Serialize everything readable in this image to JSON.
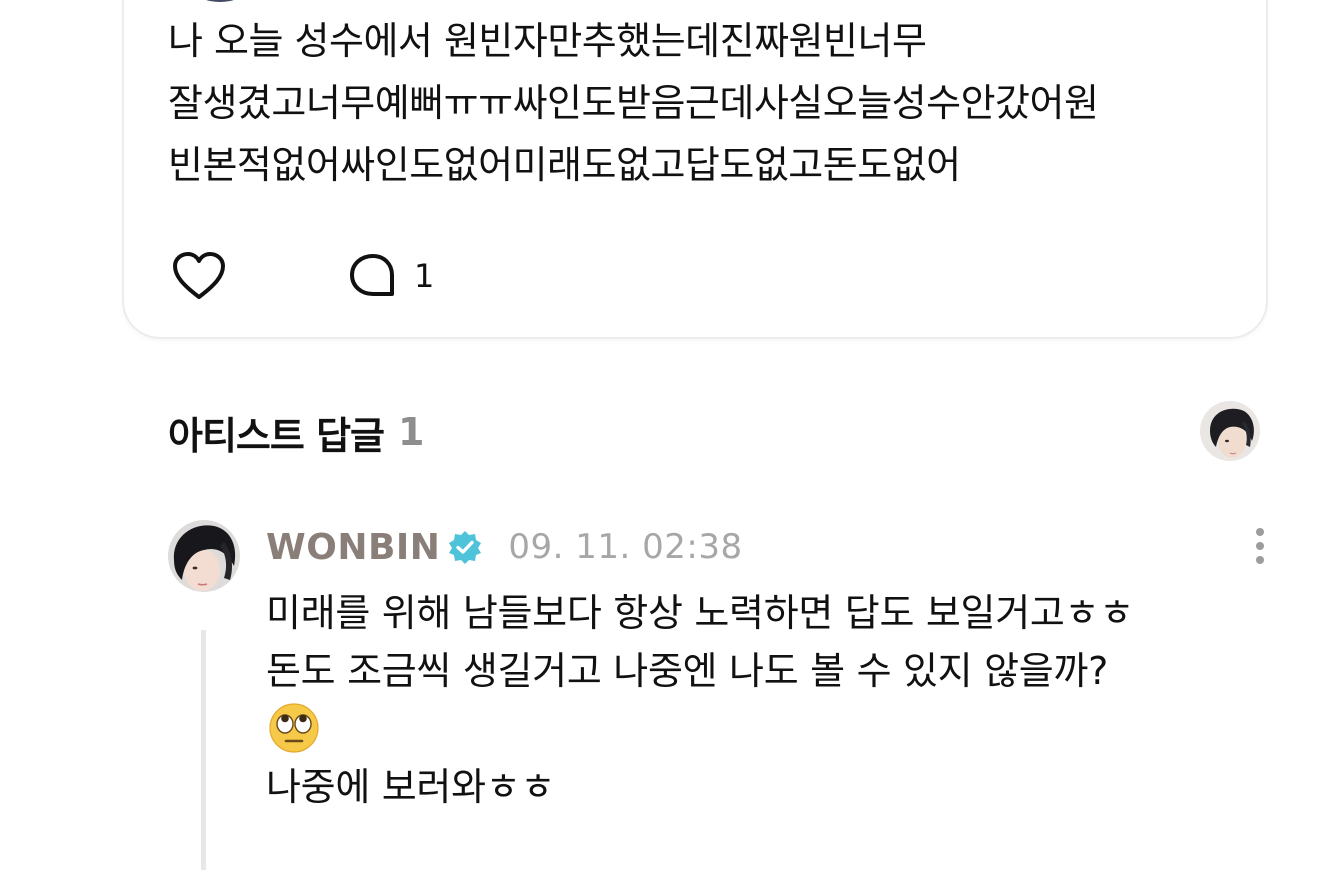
{
  "post": {
    "text": "나 오늘 성수에서 원빈자만추했는데진짜원빈너무\n잘생겼고너무예뻐ㅠㅠ싸인도받음근데사실오늘성수안갔어원\n빈본적없어싸인도없어미래도없고답도없고돈도없어",
    "comment_count": "1"
  },
  "replies": {
    "title": "아티스트 답글",
    "count": "1"
  },
  "reply": {
    "author": "WONBIN",
    "time": "09. 11. 02:38",
    "line1": "미래를 위해 남들보다 항상 노력하면 답도 보일거고ㅎㅎ",
    "line2": "돈도 조금씩 생길거고 나중엔  나도 볼 수 있지 않을까?",
    "emoji": "face-with-rolling-eyes",
    "line3": "나중에 보러와ㅎㅎ"
  },
  "colors": {
    "verified": "#4fc3d9",
    "author": "#8a7e78",
    "muted": "#a7a7a7"
  },
  "icons": {
    "like": "heart-outline-icon",
    "comment": "speech-bubble-icon",
    "verified": "verified-badge-icon",
    "more": "more-vertical-icon"
  }
}
